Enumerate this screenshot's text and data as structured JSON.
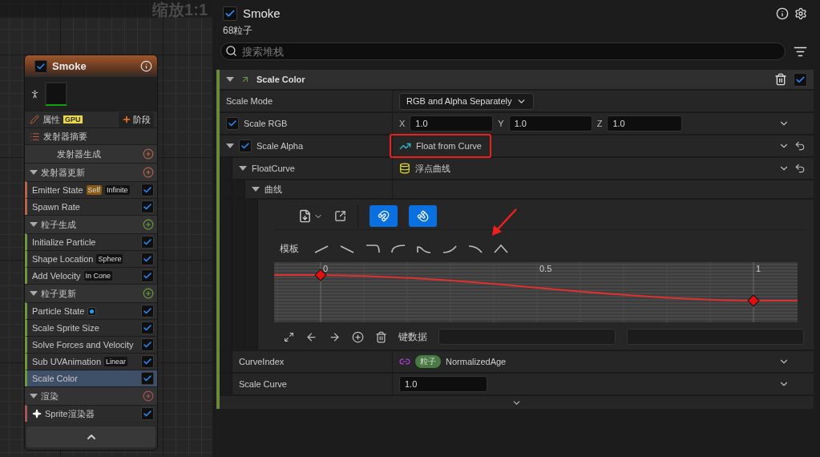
{
  "canvas": {
    "zoom_label": "缩放1:1"
  },
  "emitter": {
    "title": "Smoke",
    "enabled": true,
    "properties_label": "属性",
    "gpu_badge": "GPU",
    "stage_button": "阶段",
    "sections": [
      {
        "kind": "summary",
        "label": "发射器摘要"
      },
      {
        "kind": "stage",
        "label": "发射器生成",
        "color": "#b5634a"
      },
      {
        "kind": "group",
        "label": "发射器更新",
        "color": "#b5634a",
        "items": [
          {
            "kind": "module",
            "label": "Emitter State",
            "tags": [
              {
                "kind": "source",
                "text": "Self"
              },
              {
                "kind": "value",
                "text": "Infinite"
              }
            ],
            "checked": true,
            "selected": false
          },
          {
            "kind": "module",
            "label": "Spawn Rate",
            "checked": true,
            "selected": false
          }
        ]
      },
      {
        "kind": "group",
        "label": "粒子生成",
        "color": "#6c9a3c",
        "items": [
          {
            "kind": "module",
            "label": "Initialize Particle",
            "checked": true,
            "selected": false
          },
          {
            "kind": "module",
            "label": "Shape Location",
            "tags": [
              {
                "kind": "value",
                "text": "Sphere"
              }
            ],
            "checked": true,
            "selected": false
          },
          {
            "kind": "module",
            "label": "Add Velocity",
            "tags": [
              {
                "kind": "value",
                "text": "In Cone"
              }
            ],
            "checked": true,
            "selected": false
          }
        ]
      },
      {
        "kind": "group",
        "label": "粒子更新",
        "color": "#6c9a3c",
        "items": [
          {
            "kind": "module",
            "label": "Particle State",
            "tags": [
              {
                "kind": "dot"
              }
            ],
            "checked": true,
            "selected": false
          },
          {
            "kind": "module",
            "label": "Scale Sprite Size",
            "checked": true,
            "selected": false
          },
          {
            "kind": "module",
            "label": "Solve Forces and Velocity",
            "checked": true,
            "selected": false
          },
          {
            "kind": "module",
            "label": "Sub UVAnimation",
            "tags": [
              {
                "kind": "value",
                "text": "Linear"
              }
            ],
            "checked": true,
            "selected": false
          },
          {
            "kind": "module",
            "label": "Scale Color",
            "checked": true,
            "selected": true
          }
        ]
      },
      {
        "kind": "group",
        "label": "渲染",
        "color": "#a85656",
        "items": [
          {
            "kind": "renderer",
            "label": "Sprite渲染器",
            "checked": true,
            "selected": false
          }
        ]
      }
    ]
  },
  "stack": {
    "title": "Smoke",
    "enabled": true,
    "particle_count": "68粒子",
    "search_placeholder": "搜索堆栈"
  },
  "module": {
    "title": "Scale Color",
    "enabled": true,
    "rows": [
      {
        "kind": "dropdown",
        "label": "Scale Mode",
        "value": "RGB and Alpha Separately"
      },
      {
        "kind": "vector",
        "label": "Scale RGB",
        "checked": true,
        "reset": false,
        "fields": [
          {
            "axis": "X",
            "value": "1.0"
          },
          {
            "axis": "Y",
            "value": "1.0"
          },
          {
            "axis": "Z",
            "value": "1.0"
          }
        ]
      },
      {
        "kind": "function",
        "label": "Scale Alpha",
        "checked": true,
        "expanded": true,
        "reset": true,
        "value": "Float from Curve",
        "children": [
          {
            "kind": "asset",
            "label": "FloatCurve",
            "expanded": true,
            "reset": true,
            "value": "浮点曲线",
            "children": [
              {
                "kind": "heading",
                "label": "曲线",
                "expanded": true,
                "children": [
                  {
                    "kind": "curve",
                    "templates_label": "模板",
                    "key_data_label": "键数据",
                    "x_ticks": [
                      "0",
                      "0.5",
                      "1"
                    ]
                  }
                ]
              }
            ]
          },
          {
            "kind": "binding",
            "label": "CurveIndex",
            "reset": false,
            "namespace": "粒子",
            "value": "NormalizedAge"
          },
          {
            "kind": "number",
            "label": "Scale Curve",
            "reset": false,
            "value": "1.0"
          }
        ]
      }
    ]
  }
}
